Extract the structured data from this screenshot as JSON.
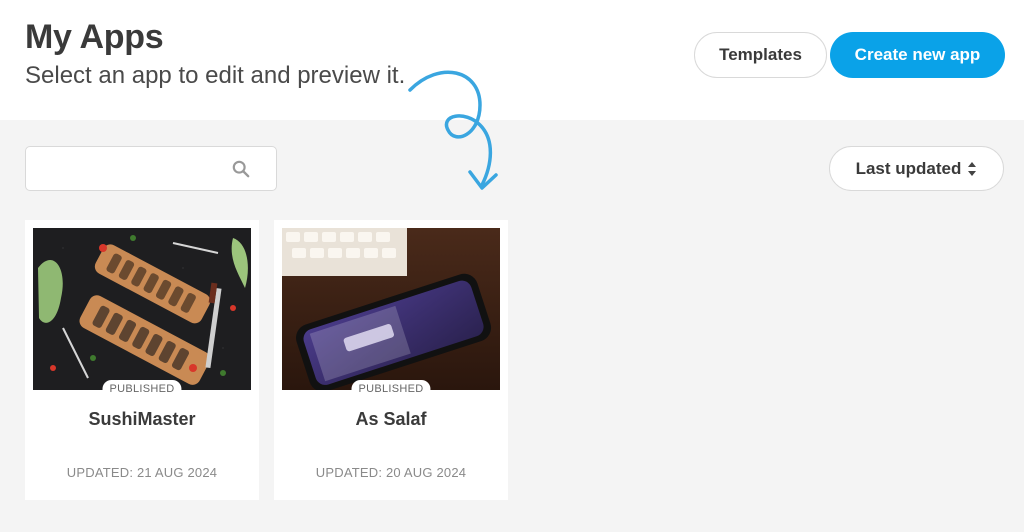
{
  "header": {
    "title": "My Apps",
    "subtitle": "Select an app to edit and preview it.",
    "templates_label": "Templates",
    "create_label": "Create new app"
  },
  "toolbar": {
    "search_value": "",
    "search_placeholder": "",
    "sort_label": "Last updated"
  },
  "apps": [
    {
      "name": "SushiMaster",
      "status": "PUBLISHED",
      "updated": "UPDATED: 21 AUG 2024",
      "thumbnail": "sushi-platter-photo"
    },
    {
      "name": "As Salaf",
      "status": "PUBLISHED",
      "updated": "UPDATED: 20 AUG 2024",
      "thumbnail": "smartphone-on-desk-photo"
    }
  ],
  "colors": {
    "accent": "#0aa2e8",
    "background": "#f4f4f4",
    "arrow": "#3aa6e0"
  },
  "icons": [
    "search-icon",
    "sort-icon",
    "curly-arrow-icon"
  ]
}
